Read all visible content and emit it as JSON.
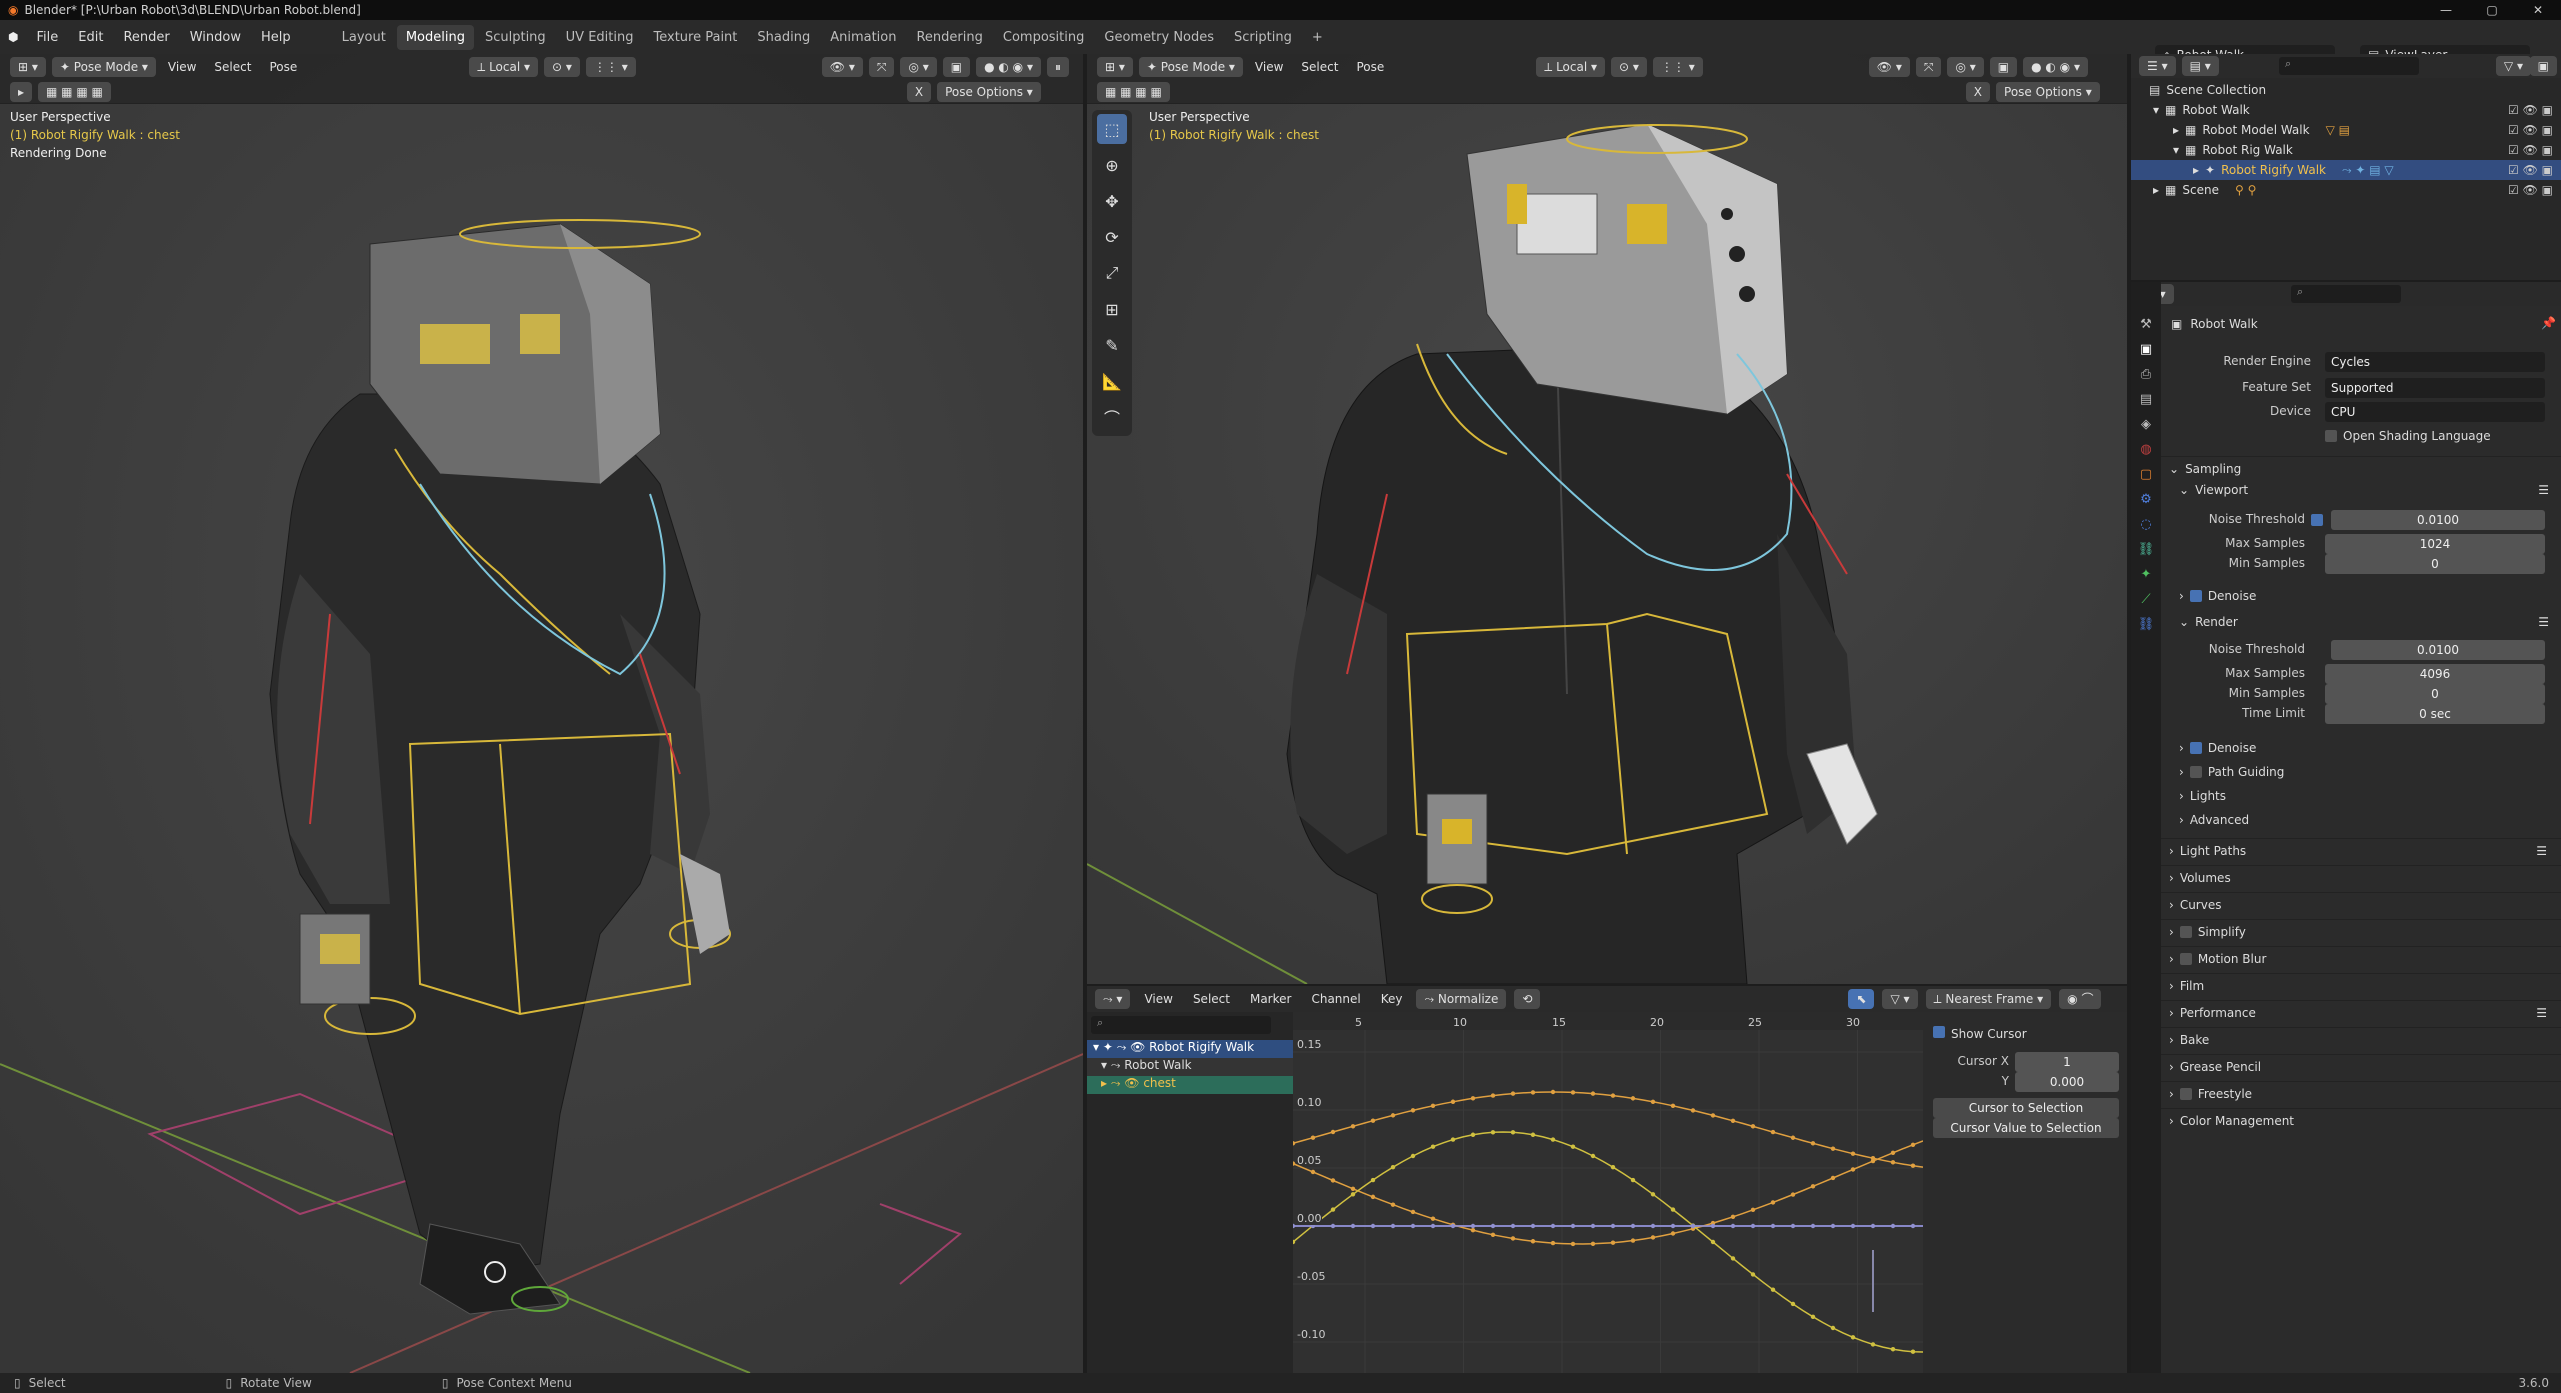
{
  "window": {
    "title": "Blender* [P:\\Urban Robot\\3d\\BLEND\\Urban Robot.blend]",
    "controls": [
      "—",
      "▢",
      "✕"
    ]
  },
  "menu": {
    "items": [
      "File",
      "Edit",
      "Render",
      "Window",
      "Help"
    ]
  },
  "workspaces": [
    "Layout",
    "Modeling",
    "Sculpting",
    "UV Editing",
    "Texture Paint",
    "Shading",
    "Animation",
    "Rendering",
    "Compositing",
    "Geometry Nodes",
    "Scripting",
    "+"
  ],
  "active_workspace": "Modeling",
  "scene_selector": "Robot Walk",
  "view_layer": "ViewLayer",
  "viewport_left": {
    "mode": "Pose Mode",
    "menus": [
      "View",
      "Select",
      "Pose"
    ],
    "transform": "Local",
    "pose_options": "Pose Options",
    "overlay_line1": "User Perspective",
    "overlay_line2": "(1) Robot Rigify Walk : chest",
    "overlay_line3": "Rendering Done"
  },
  "viewport_right": {
    "mode": "Pose Mode",
    "menus": [
      "View",
      "Select",
      "Pose"
    ],
    "transform": "Local",
    "pose_options": "Pose Options",
    "overlay_line1": "User Perspective",
    "overlay_line2": "(1) Robot Rigify Walk : chest",
    "tools": [
      "select-box",
      "cursor",
      "move",
      "rotate",
      "scale",
      "transform",
      "annotate",
      "measure",
      "pose-relax"
    ]
  },
  "outliner": {
    "rows": [
      {
        "label": "Scene Collection",
        "indent": 0
      },
      {
        "label": "Robot Walk",
        "indent": 1
      },
      {
        "label": "Robot Model Walk",
        "indent": 2
      },
      {
        "label": "Robot Rig Walk",
        "indent": 2
      },
      {
        "label": "Robot Rigify Walk",
        "indent": 3,
        "selected": true
      },
      {
        "label": "Scene",
        "indent": 1
      }
    ]
  },
  "properties": {
    "context": "Robot Walk",
    "render_engine_label": "Render Engine",
    "render_engine": "Cycles",
    "feature_set_label": "Feature Set",
    "feature_set": "Supported",
    "device_label": "Device",
    "device": "CPU",
    "osl_label": "Open Shading Language",
    "sampling": "Sampling",
    "viewport": "Viewport",
    "vp_noise_label": "Noise Threshold",
    "vp_noise": "0.0100",
    "vp_max_label": "Max Samples",
    "vp_max": "1024",
    "vp_min_label": "Min Samples",
    "vp_min": "0",
    "denoise1": "Denoise",
    "render": "Render",
    "r_noise_label": "Noise Threshold",
    "r_noise": "0.0100",
    "r_max_label": "Max Samples",
    "r_max": "4096",
    "r_min_label": "Min Samples",
    "r_min": "0",
    "r_time_label": "Time Limit",
    "r_time": "0 sec",
    "denoise2": "Denoise",
    "path_guiding": "Path Guiding",
    "lights": "Lights",
    "advanced": "Advanced",
    "panels": [
      "Light Paths",
      "Volumes",
      "Curves",
      "Simplify",
      "Motion Blur",
      "Film",
      "Performance",
      "Bake",
      "Grease Pencil",
      "Freestyle",
      "Color Management"
    ]
  },
  "graph_editor": {
    "menus": [
      "View",
      "Select",
      "Marker",
      "Channel",
      "Key"
    ],
    "normalize": "Normalize",
    "snap": "Nearest Frame",
    "channels": [
      "Robot Rigify Walk",
      "Robot Walk",
      "chest"
    ],
    "frame_ticks": [
      "5",
      "10",
      "15",
      "20",
      "25",
      "30"
    ],
    "value_ticks": [
      "0.15",
      "0.10",
      "0.05",
      "0.00",
      "-0.05",
      "-0.10"
    ],
    "show_cursor": "Show Cursor",
    "cursor_x_label": "Cursor X",
    "cursor_x": "1",
    "cursor_y_label": "Y",
    "cursor_y": "0.000",
    "btn_cursor_sel": "Cursor to Selection",
    "btn_cursor_val": "Cursor Value to Selection"
  },
  "status_bar": {
    "select": "Select",
    "rotate": "Rotate View",
    "context": "Pose Context Menu",
    "version": "3.6.0"
  }
}
